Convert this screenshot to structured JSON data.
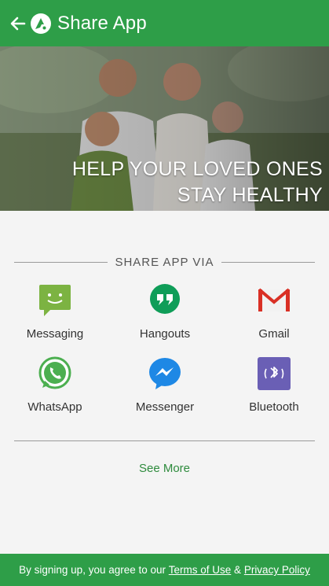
{
  "appbar": {
    "title": "Share App",
    "back_icon": "arrow-left-icon",
    "logo_icon": "app-logo-icon"
  },
  "hero": {
    "line1": "HELP YOUR LOVED ONES",
    "line2": "STAY HEALTHY"
  },
  "share": {
    "heading": "SHARE APP VIA",
    "apps": [
      {
        "label": "Messaging",
        "icon": "messaging-icon"
      },
      {
        "label": "Hangouts",
        "icon": "hangouts-icon"
      },
      {
        "label": "Gmail",
        "icon": "gmail-icon"
      },
      {
        "label": "WhatsApp",
        "icon": "whatsapp-icon"
      },
      {
        "label": "Messenger",
        "icon": "messenger-icon"
      },
      {
        "label": "Bluetooth",
        "icon": "bluetooth-icon"
      }
    ],
    "see_more": "See More"
  },
  "footer": {
    "prefix": "By signing up, you agree to our ",
    "terms": "Terms of Use",
    "amp": " & ",
    "privacy": "Privacy Policy"
  },
  "colors": {
    "brand_green": "#2e9e48",
    "link_green": "#2e8b3d"
  }
}
